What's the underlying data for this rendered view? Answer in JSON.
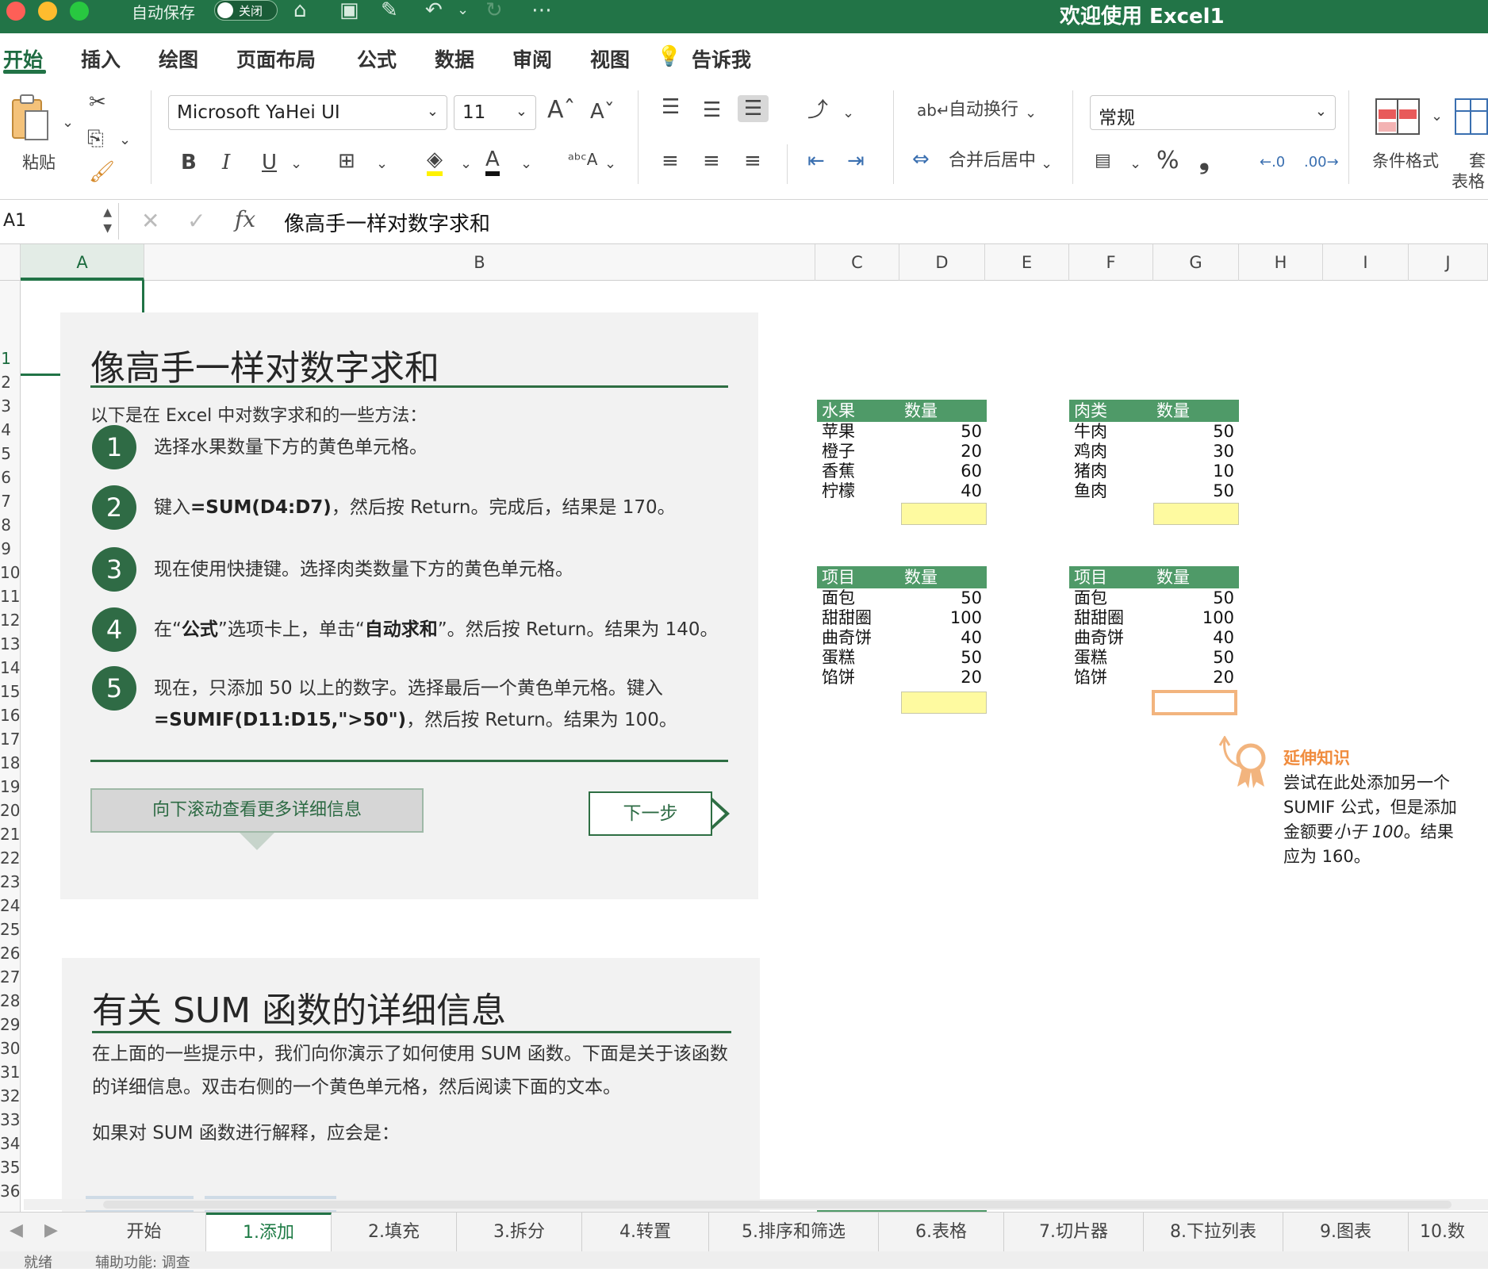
{
  "titlebar": {
    "autosave_label": "自动保存",
    "autosave_state": "关闭",
    "window_title": "欢迎使用 Excel1"
  },
  "ribbon_tabs": [
    "开始",
    "插入",
    "绘图",
    "页面布局",
    "公式",
    "数据",
    "审阅",
    "视图"
  ],
  "tell_me": "告诉我",
  "toolbar": {
    "paste_label": "粘贴",
    "font_name": "Microsoft YaHei UI",
    "font_size": "11",
    "bold": "B",
    "italic": "I",
    "underline": "U",
    "wrap_text": "自动换行",
    "merge_center": "合并后居中",
    "number_format": "常规",
    "percent": "%",
    "comma": "❟",
    "conditional_format": "条件格式",
    "table_format_1": "套",
    "table_format_2": "表格",
    "accent_color": "#227447"
  },
  "formula_bar": {
    "name_box": "A1",
    "fx": "fx",
    "content": "像高手一样对数字求和"
  },
  "columns": [
    "A",
    "B",
    "C",
    "D",
    "E",
    "F",
    "G",
    "H",
    "I",
    "J"
  ],
  "rows": [
    "1",
    "2",
    "3",
    "4",
    "5",
    "6",
    "7",
    "8",
    "9",
    "10",
    "11",
    "12",
    "13",
    "14",
    "15",
    "16",
    "17",
    "18",
    "19",
    "20",
    "21",
    "22",
    "23",
    "24",
    "25",
    "26",
    "27",
    "28",
    "29",
    "30",
    "31",
    "32",
    "33",
    "34",
    "35",
    "36"
  ],
  "panel1": {
    "title": "像高手一样对数字求和",
    "intro": "以下是在 Excel 中对数字求和的一些方法：",
    "steps": [
      {
        "num": "1",
        "text": "选择水果数量下方的黄色单元格。"
      },
      {
        "num": "2",
        "pre": "键入",
        "bold": "=SUM(D4:D7)",
        "post": "，然后按 Return。完成后，结果是 170。"
      },
      {
        "num": "3",
        "text": "现在使用快捷键。选择肉类数量下方的黄色单元格。"
      },
      {
        "num": "4",
        "pre": "在“",
        "bold": "公式",
        "mid": "”选项卡上，单击“",
        "bold2": "自动求和",
        "post": "”。然后按 Return。结果为 140。"
      },
      {
        "num": "5",
        "line1": "现在，只添加 50 以上的数字。选择最后一个黄色单元格。键入",
        "bold": "=SUMIF(D11:D15,\">50\")",
        "post": "，然后按 Return。结果为 100。"
      }
    ],
    "scroll_button": "向下滚动查看更多详细信息",
    "next_button": "下一步"
  },
  "panel2": {
    "title": "有关 SUM 函数的详细信息",
    "paragraph": "在上面的一些提示中，我们向你演示了如何使用 SUM 函数。下面是关于该函数的详细信息。双击右侧的一个黄色单元格，然后阅读下面的文本。",
    "explain": "如果对 SUM 函数进行解释，应会是："
  },
  "tables": {
    "fruit": {
      "h1": "水果",
      "h2": "数量",
      "rows": [
        [
          "苹果",
          "50"
        ],
        [
          "橙子",
          "20"
        ],
        [
          "香蕉",
          "60"
        ],
        [
          "柠檬",
          "40"
        ]
      ]
    },
    "meat": {
      "h1": "肉类",
      "h2": "数量",
      "rows": [
        [
          "牛肉",
          "50"
        ],
        [
          "鸡肉",
          "30"
        ],
        [
          "猪肉",
          "10"
        ],
        [
          "鱼肉",
          "50"
        ]
      ]
    },
    "items1": {
      "h1": "项目",
      "h2": "数量",
      "rows": [
        [
          "面包",
          "50"
        ],
        [
          "甜甜圈",
          "100"
        ],
        [
          "曲奇饼",
          "40"
        ],
        [
          "蛋糕",
          "50"
        ],
        [
          "馅饼",
          "20"
        ]
      ]
    },
    "items2": {
      "h1": "项目",
      "h2": "数量",
      "rows": [
        [
          "面包",
          "50"
        ],
        [
          "甜甜圈",
          "100"
        ],
        [
          "曲奇饼",
          "40"
        ],
        [
          "蛋糕",
          "50"
        ],
        [
          "馅饼",
          "20"
        ]
      ]
    }
  },
  "tip": {
    "title": "延伸知识",
    "line1": "尝试在此处添加另一个 SUMIF 公式，但是添加金额要",
    "italic": "小于 100",
    "line2": "。结果应为 160。",
    "color": "#f08c3e"
  },
  "sheet_tabs": [
    "开始",
    "1.添加",
    "2.填充",
    "3.拆分",
    "4.转置",
    "5.排序和筛选",
    "6.表格",
    "7.切片器",
    "8.下拉列表",
    "9.图表",
    "10.数"
  ],
  "status": {
    "ready": "就绪",
    "accessibility": "辅助功能: 调查"
  }
}
